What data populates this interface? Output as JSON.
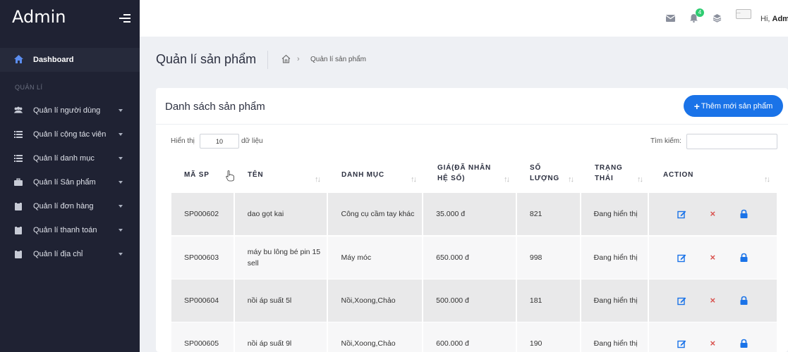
{
  "sidebar": {
    "brand": "Admin",
    "dashboard": "Dashboard",
    "section": "QUẢN LÍ",
    "items": [
      {
        "label": "Quản lí người dùng",
        "icon": "users-icon"
      },
      {
        "label": "Quản lí cộng tác viên",
        "icon": "list-icon"
      },
      {
        "label": "Quản lí danh mục",
        "icon": "list-icon"
      },
      {
        "label": "Quản lí Sản phẩm",
        "icon": "briefcase-icon"
      },
      {
        "label": "Quản lí đơn hàng",
        "icon": "clipboard-icon"
      },
      {
        "label": "Quản lí thanh toán",
        "icon": "clipboard-icon"
      },
      {
        "label": "Quản lí địa chỉ",
        "icon": "clipboard-icon"
      }
    ]
  },
  "topbar": {
    "notification_count": "4",
    "avatar_alt": "...",
    "greeting": "Hi,",
    "user": "Adm"
  },
  "page": {
    "title": "Quản lí sản phẩm",
    "breadcrumb": "Quản lí sản phẩm"
  },
  "card": {
    "title": "Danh sách sản phẩm",
    "add_button": "Thêm mới sản phẩm",
    "show_label": "Hiển thị",
    "show_value": "10",
    "show_suffix": "dữ liệu",
    "search_label": "Tìm kiếm:"
  },
  "table": {
    "headers": [
      {
        "l1": "MÃ SP",
        "l2": ""
      },
      {
        "l1": "TÊN",
        "l2": ""
      },
      {
        "l1": "DANH MỤC",
        "l2": ""
      },
      {
        "l1": "GIÁ(ĐÃ NHÂN",
        "l2": "HỆ SỐ)"
      },
      {
        "l1": "SỐ",
        "l2": "LƯỢNG"
      },
      {
        "l1": "TRẠNG",
        "l2": "THÁI"
      },
      {
        "l1": "ACTION",
        "l2": ""
      }
    ],
    "rows": [
      {
        "code": "SP000602",
        "name": "dao gọt kai",
        "category": "Công cụ cầm tay khác",
        "price": "35.000 đ",
        "qty": "821",
        "status": "Đang hiển thị"
      },
      {
        "code": "SP000603",
        "name": "máy bu lông bé pin 15 sell",
        "category": "Máy móc",
        "price": "650.000 đ",
        "qty": "998",
        "status": "Đang hiển thị"
      },
      {
        "code": "SP000604",
        "name": "nồi áp suất 5l",
        "category": "Nồi,Xoong,Chảo",
        "price": "500.000 đ",
        "qty": "181",
        "status": "Đang hiển thị"
      },
      {
        "code": "SP000605",
        "name": "nồi áp suất 9l",
        "category": "Nồi,Xoong,Chảo",
        "price": "600.000 đ",
        "qty": "190",
        "status": "Đang hiển thị"
      }
    ],
    "action_delete_glyph": "×"
  },
  "colors": {
    "sidebar_bg": "#1f2233",
    "primary": "#1a73e8",
    "danger": "#d9534f",
    "badge": "#2ecc71"
  }
}
